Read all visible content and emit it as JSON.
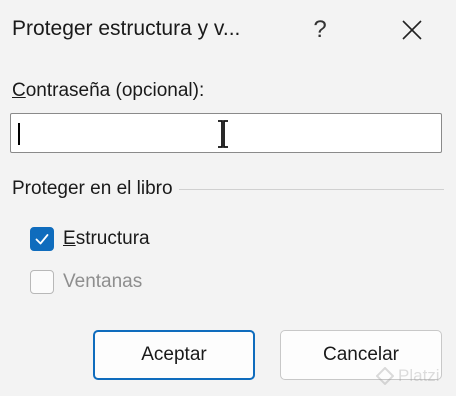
{
  "dialog": {
    "title": "Proteger estructura y v...",
    "help_label": "?",
    "close_icon": "close-icon"
  },
  "password": {
    "label_accel": "C",
    "label_rest": "ontraseña (opcional):",
    "value": ""
  },
  "protect_group": {
    "label": "Proteger en el libro",
    "structure": {
      "accel": "E",
      "rest": "structura",
      "checked": true
    },
    "windows": {
      "accel": "V",
      "rest": "entanas",
      "checked": false,
      "disabled": true
    }
  },
  "buttons": {
    "ok_label": "Aceptar",
    "cancel_label": "Cancelar"
  },
  "colors": {
    "accent": "#0f6cbd",
    "background": "#f3f3f3",
    "disabled_text": "#8e8e8e"
  },
  "watermark": {
    "text": "Platzi"
  }
}
